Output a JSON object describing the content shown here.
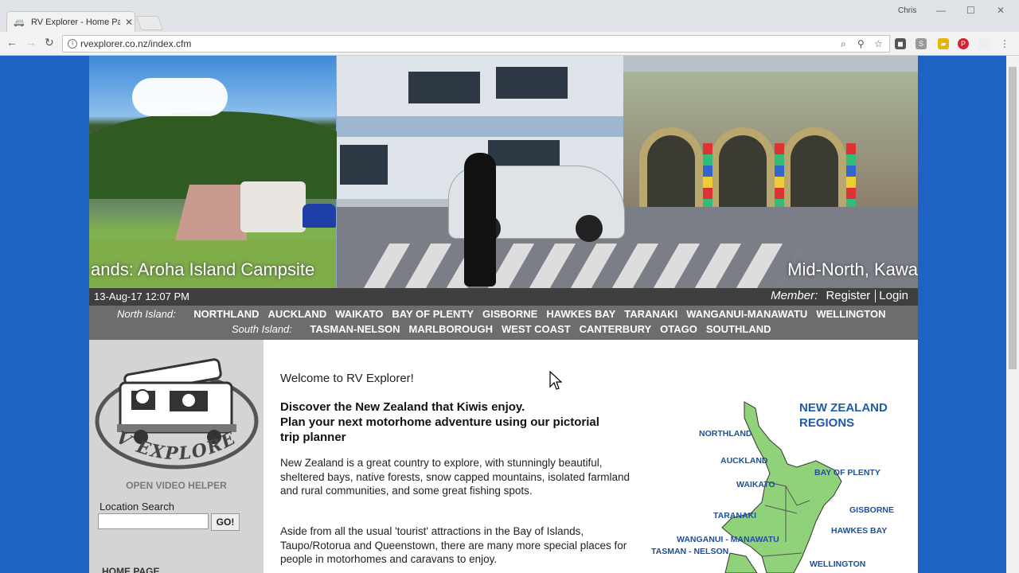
{
  "browser": {
    "tab_title": "RV Explorer - Home Page",
    "url": "rvexplorer.co.nz/index.cfm",
    "profile_name": "Chris"
  },
  "banner": {
    "caption_left": "ands: Aroha Island Campsite",
    "caption_right": "Mid-North, Kawa"
  },
  "infobar": {
    "datetime": "13-Aug-17 12:07 PM",
    "member_label": "Member:",
    "register": "Register",
    "login": "Login"
  },
  "regions": {
    "north_label": "North Island:",
    "north": [
      "NORTHLAND",
      "AUCKLAND",
      "WAIKATO",
      "BAY OF PLENTY",
      "GISBORNE",
      "HAWKES BAY",
      "TARANAKI",
      "WANGANUI-MANAWATU",
      "WELLINGTON"
    ],
    "south_label": "South Island:",
    "south": [
      "TASMAN-NELSON",
      "MARLBOROUGH",
      "WEST COAST",
      "CANTERBURY",
      "OTAGO",
      "SOUTHLAND"
    ]
  },
  "sidebar": {
    "logo_text": "RV EXPLORER",
    "video_helper": "OPEN VIDEO HELPER",
    "location_label": "Location Search",
    "location_value": "",
    "go_label": "GO!",
    "home_page_partial": "HOME PAGE"
  },
  "content": {
    "welcome": "Welcome to RV Explorer!",
    "tagline_1": "Discover the New Zealand that Kiwis enjoy.",
    "tagline_2": "Plan your next motorhome adventure using our pictorial trip planner",
    "para_1": "New Zealand is a great country to explore, with stunningly beautiful, sheltered bays, native forests, snow capped mountains, isolated farmland and rural communities, and some great fishing spots.",
    "para_2": "Aside from all the usual 'tourist' attractions in the Bay of Islands, Taupo/Rotorua and Queenstown, there are many more special places for people in motorhomes and caravans to enjoy."
  },
  "map": {
    "title_1": "NEW ZEALAND",
    "title_2": "REGIONS",
    "labels": {
      "northland": "NORTHLAND",
      "auckland": "AUCKLAND",
      "bay_of_plenty": "BAY OF PLENTY",
      "waikato": "WAIKATO",
      "gisborne": "GISBORNE",
      "taranaki": "TARANAKI",
      "hawkes_bay": "HAWKES BAY",
      "wanganui": "WANGANUI - MANAWATU",
      "tasman": "TASMAN - NELSON",
      "wellington": "WELLINGTON"
    }
  },
  "colors": {
    "page_background": "#1e63c4",
    "infobar": "#3f3f3f",
    "regionbar": "#6d6d6d",
    "sidebar": "#d4d4d4",
    "map_land": "#8fd27a",
    "map_text": "#1f5ba8"
  }
}
